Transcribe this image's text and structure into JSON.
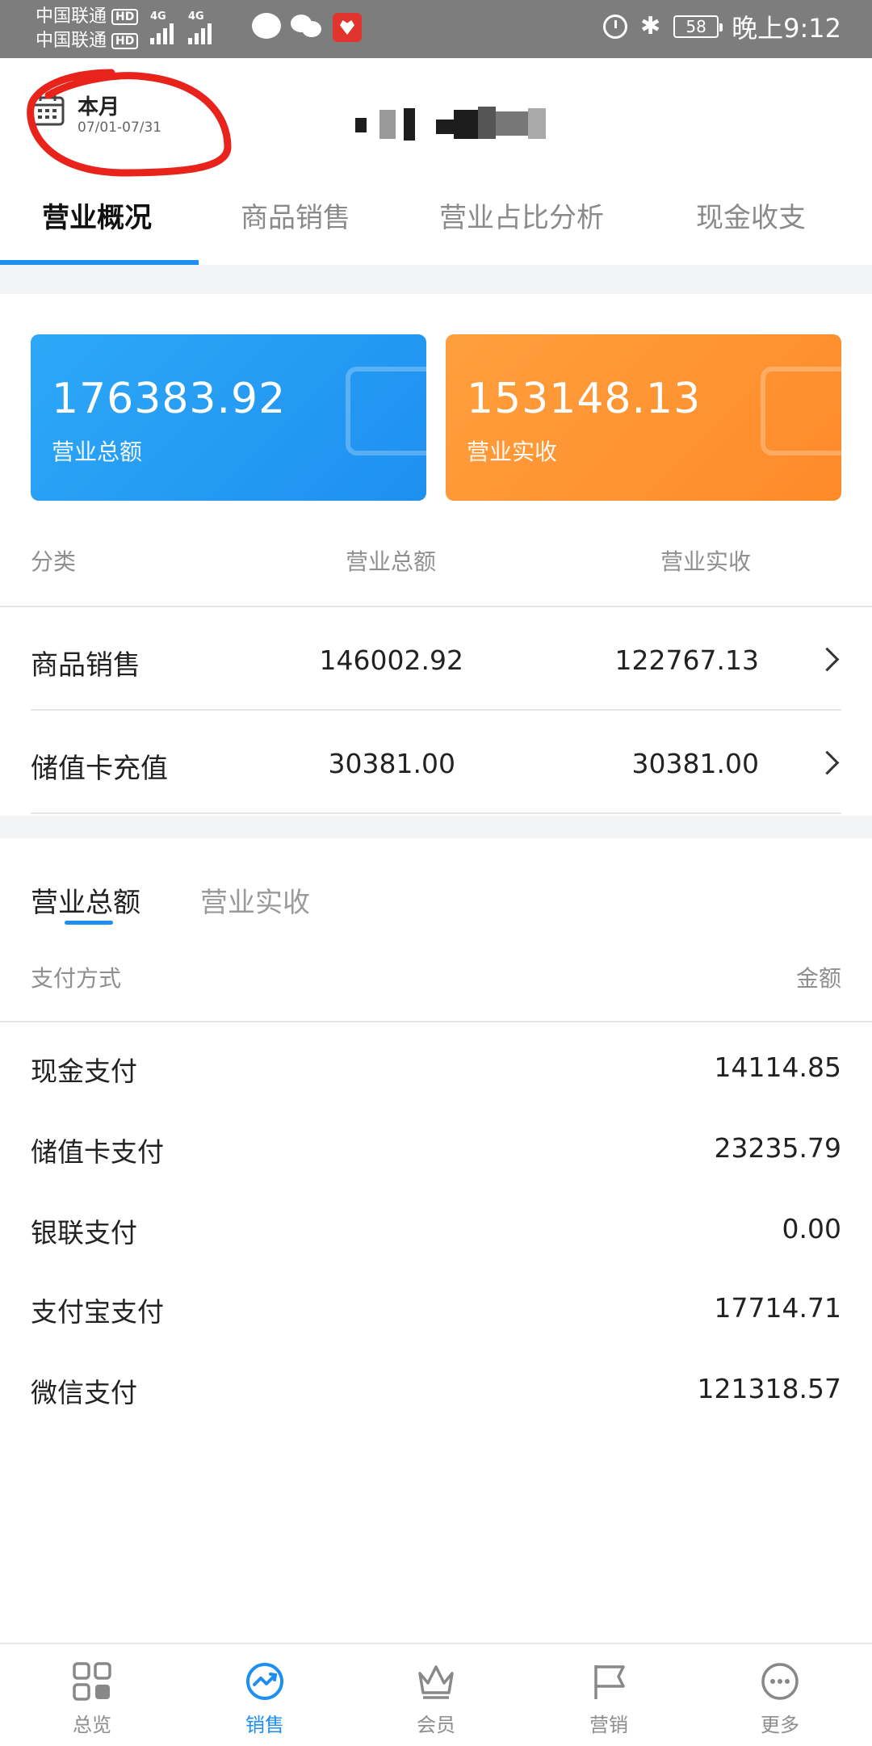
{
  "status_bar": {
    "carrier_1": "中国联通",
    "carrier_2": "中国联通",
    "hd": "HD",
    "network_1": "4G",
    "network_2": "4G",
    "battery": "58",
    "time": "晚上9:12",
    "bluetooth": "✱"
  },
  "header": {
    "date_title": "本月",
    "date_range": "07/01-07/31"
  },
  "tabs": [
    "营业概况",
    "商品销售",
    "营业占比分析",
    "现金收支"
  ],
  "cards": {
    "total": {
      "value": "176383.92",
      "label": "营业总额"
    },
    "received": {
      "value": "153148.13",
      "label": "营业实收"
    }
  },
  "category_table": {
    "headers": [
      "分类",
      "营业总额",
      "营业实收"
    ],
    "rows": [
      {
        "name": "商品销售",
        "total": "146002.92",
        "received": "122767.13"
      },
      {
        "name": "储值卡充值",
        "total": "30381.00",
        "received": "30381.00"
      }
    ]
  },
  "sub_tabs": [
    "营业总额",
    "营业实收"
  ],
  "payment_table": {
    "headers": [
      "支付方式",
      "金额"
    ],
    "rows": [
      {
        "method": "现金支付",
        "amount": "14114.85"
      },
      {
        "method": "储值卡支付",
        "amount": "23235.79"
      },
      {
        "method": "银联支付",
        "amount": "0.00"
      },
      {
        "method": "支付宝支付",
        "amount": "17714.71"
      },
      {
        "method": "微信支付",
        "amount": "121318.57"
      }
    ]
  },
  "bottom_nav": [
    "总览",
    "销售",
    "会员",
    "营销",
    "更多"
  ],
  "colors": {
    "accent": "#1f8ef1",
    "card_blue": "#2da8f7",
    "card_orange": "#ff9a36",
    "annotation_red": "#e8231c"
  }
}
